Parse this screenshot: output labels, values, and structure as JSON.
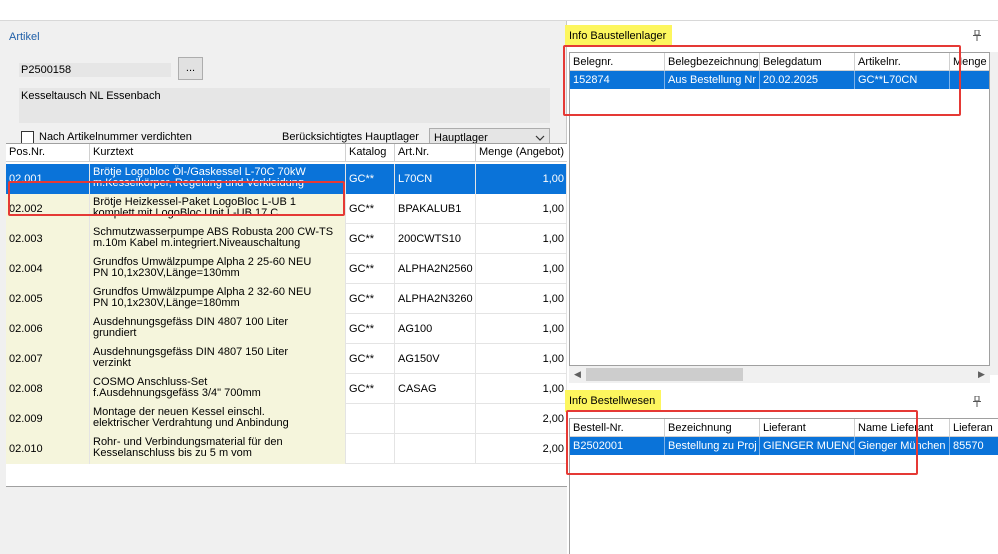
{
  "artikel": {
    "group_title": "Artikel",
    "artikelnummer": "P2500158",
    "browse_label": "...",
    "beschreibung": "Kesseltausch NL Essenbach",
    "verdichten_label": "Nach Artikelnummer verdichten",
    "hauptlager_label": "Berücksichtigtes Hauptlager",
    "hauptlager_value": "Hauptlager"
  },
  "positions": {
    "columns": [
      "Pos.Nr.",
      "Kurztext",
      "Katalog",
      "Art.Nr.",
      "Menge (Angebot)"
    ],
    "rows": [
      {
        "pos": "02.001",
        "k1": "Brötje Logobloc Öl-/Gaskessel L-70C 70kW",
        "k2": "m.Kesselkörper, Regelung und Verkleidung",
        "katalog": "GC**",
        "artnr": "L70CN",
        "menge": "1,00",
        "selected": true
      },
      {
        "pos": "02.002",
        "k1": "Brötje Heizkessel-Paket LogoBloc L-UB 1",
        "k2": "komplett mit LogoBloc Unit L-UB 17 C",
        "katalog": "GC**",
        "artnr": "BPAKALUB1",
        "menge": "1,00"
      },
      {
        "pos": "02.003",
        "k1": "Schmutzwasserpumpe ABS Robusta 200 CW-TS",
        "k2": "m.10m Kabel m.integriert.Niveauschaltung",
        "katalog": "GC**",
        "artnr": "200CWTS10",
        "menge": "1,00"
      },
      {
        "pos": "02.004",
        "k1": "Grundfos Umwälzpumpe Alpha 2 25-60 NEU",
        "k2": "PN 10,1x230V,Länge=130mm",
        "katalog": "GC**",
        "artnr": "ALPHA2N2560",
        "menge": "1,00"
      },
      {
        "pos": "02.005",
        "k1": "Grundfos Umwälzpumpe Alpha 2 32-60 NEU",
        "k2": "PN 10,1x230V,Länge=180mm",
        "katalog": "GC**",
        "artnr": "ALPHA2N3260",
        "menge": "1,00"
      },
      {
        "pos": "02.006",
        "k1": "Ausdehnungsgefäss DIN 4807 100 Liter",
        "k2": "grundiert",
        "katalog": "GC**",
        "artnr": "AG100",
        "menge": "1,00"
      },
      {
        "pos": "02.007",
        "k1": "Ausdehnungsgefäss DIN 4807 150 Liter",
        "k2": "verzinkt",
        "katalog": "GC**",
        "artnr": "AG150V",
        "menge": "1,00"
      },
      {
        "pos": "02.008",
        "k1": "COSMO Anschluss-Set",
        "k2": "f.Ausdehnungsgefäss 3/4\" 700mm",
        "katalog": "GC**",
        "artnr": "CASAG",
        "menge": "1,00"
      },
      {
        "pos": "02.009",
        "k1": "Montage der neuen Kessel einschl.",
        "k2": "elektrischer Verdrahtung und Anbindung",
        "katalog": "",
        "artnr": "",
        "menge": "2,00"
      },
      {
        "pos": "02.010",
        "k1": "Rohr- und Verbindungsmaterial für den",
        "k2": "Kesselanschluss bis zu 5 m vom",
        "katalog": "",
        "artnr": "",
        "menge": "2,00"
      }
    ]
  },
  "baustellenlager": {
    "title": "Info Baustellenlager",
    "pin": "📌",
    "columns": [
      "Belegnr.",
      "Belegbezeichnung",
      "Belegdatum",
      "Artikelnr.",
      "Menge"
    ],
    "row": [
      "152874",
      "Aus Bestellung Nr",
      "20.02.2025",
      "GC**L70CN",
      ""
    ]
  },
  "bestellwesen": {
    "title": "Info Bestellwesen",
    "pin": "📌",
    "columns": [
      "Bestell-Nr.",
      "Bezeichnung",
      "Lieferant",
      "Name Lieferant",
      "Lieferan"
    ],
    "row": [
      "B2502001",
      "Bestellung zu Proj",
      "GIENGER MUENC",
      "Gienger München",
      "85570"
    ]
  },
  "icons": {
    "scroll_left": "◀",
    "scroll_right": "▶",
    "dropdown": "▼"
  },
  "colors": {
    "selection": "#0a73d9",
    "highlight_title": "#fdf65e",
    "annotation_box": "#e53935",
    "kurztext_bg": "#f5f5dc"
  }
}
